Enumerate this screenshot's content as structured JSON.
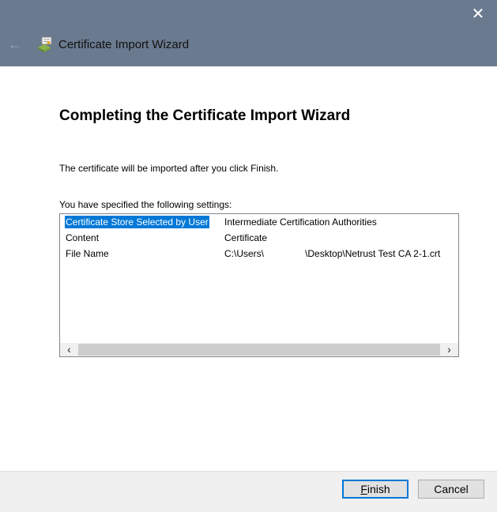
{
  "window": {
    "title": "Certificate Import Wizard",
    "close_glyph": "✕",
    "back_glyph": "←"
  },
  "page": {
    "heading": "Completing the Certificate Import Wizard",
    "intro": "The certificate will be imported after you click Finish.",
    "settings_label": "You have specified the following settings:"
  },
  "settings": [
    {
      "key": "Certificate Store Selected by User",
      "value": "Intermediate Certification Authorities",
      "selected": true
    },
    {
      "key": "Content",
      "value": "Certificate",
      "selected": false
    },
    {
      "key": "File Name",
      "value_prefix": "C:\\Users\\",
      "value_suffix": "\\Desktop\\Netrust Test CA 2-1.crt",
      "selected": false
    }
  ],
  "scrollbar": {
    "left_glyph": "‹",
    "right_glyph": "›"
  },
  "footer": {
    "finish_accel": "F",
    "finish_rest": "inish",
    "cancel_label": "Cancel"
  },
  "colors": {
    "titlebar": "#6a7a8f",
    "selection": "#0078d7",
    "footer": "#f0f0f0"
  }
}
